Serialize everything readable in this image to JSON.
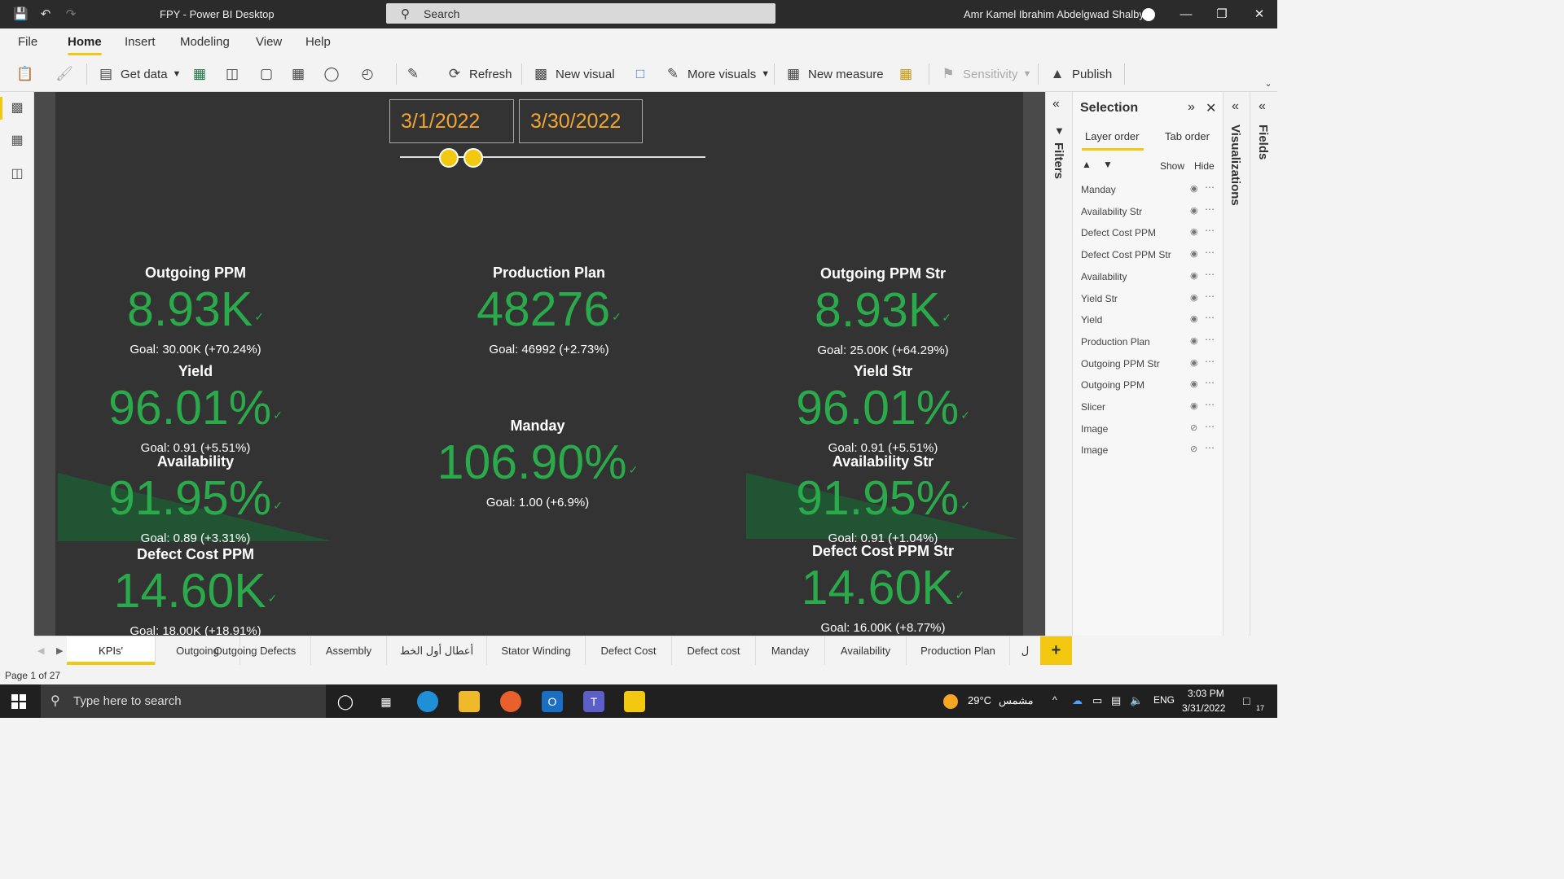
{
  "window": {
    "title": "FPY - Power BI Desktop",
    "search_placeholder": "Search",
    "user_name": "Amr Kamel Ibrahim Abdelgwad Shalby"
  },
  "menu": {
    "tabs": [
      {
        "label": "File"
      },
      {
        "label": "Home"
      },
      {
        "label": "Insert"
      },
      {
        "label": "Modeling"
      },
      {
        "label": "View"
      },
      {
        "label": "Help"
      }
    ],
    "active": "Home"
  },
  "ribbon": {
    "get_data": "Get data",
    "refresh": "Refresh",
    "new_visual": "New visual",
    "more_visuals": "More visuals",
    "new_measure": "New measure",
    "sensitivity": "Sensitivity",
    "publish": "Publish"
  },
  "report": {
    "date_start": "3/1/2022",
    "date_end": "3/30/2022",
    "slider": {
      "start_fraction": 0.16,
      "end_fraction": 0.24
    },
    "kpis": {
      "outgoing_ppm": {
        "title": "Outgoing PPM",
        "value": "8.93K",
        "goal": "Goal: 30.00K (+70.24%)"
      },
      "yield": {
        "title": "Yield",
        "value": "96.01%",
        "goal": "Goal: 0.91 (+5.51%)"
      },
      "availability": {
        "title": "Availability",
        "value": "91.95%",
        "goal": "Goal: 0.89 (+3.31%)"
      },
      "defect_cost_ppm": {
        "title": "Defect Cost PPM",
        "value": "14.60K",
        "goal": "Goal: 18.00K (+18.91%)"
      },
      "production_plan": {
        "title": "Production Plan",
        "value": "48276",
        "goal": "Goal: 46992 (+2.73%)"
      },
      "manday": {
        "title": "Manday",
        "value": "106.90%",
        "goal": "Goal: 1.00 (+6.9%)"
      },
      "outgoing_ppm_str": {
        "title": "Outgoing PPM Str",
        "value": "8.93K",
        "goal": "Goal: 25.00K (+64.29%)"
      },
      "yield_str": {
        "title": "Yield Str",
        "value": "96.01%",
        "goal": "Goal: 0.91 (+5.51%)"
      },
      "availability_str": {
        "title": "Availability Str",
        "value": "91.95%",
        "goal": "Goal: 0.91 (+1.04%)"
      },
      "defect_cost_ppm_str": {
        "title": "Defect Cost PPM Str",
        "value": "14.60K",
        "goal": "Goal: 16.00K (+8.77%)"
      }
    },
    "check_glyph": "✓"
  },
  "panes": {
    "filters": "Filters",
    "visualizations": "Visualizations",
    "fields": "Fields",
    "selection": {
      "title": "Selection",
      "tab_layer": "Layer order",
      "tab_tab": "Tab order",
      "show": "Show",
      "hide": "Hide",
      "layers": [
        {
          "name": "Manday",
          "visible": true
        },
        {
          "name": "Availability Str",
          "visible": true
        },
        {
          "name": "Defect Cost PPM",
          "visible": true
        },
        {
          "name": "Defect Cost PPM Str",
          "visible": true
        },
        {
          "name": "Availability",
          "visible": true
        },
        {
          "name": "Yield Str",
          "visible": true
        },
        {
          "name": "Yield",
          "visible": true
        },
        {
          "name": "Production Plan",
          "visible": true
        },
        {
          "name": "Outgoing PPM Str",
          "visible": true
        },
        {
          "name": "Outgoing PPM",
          "visible": true
        },
        {
          "name": "Slicer",
          "visible": true
        },
        {
          "name": "Image",
          "visible": false
        },
        {
          "name": "Image",
          "visible": false
        }
      ]
    }
  },
  "page_tabs": [
    {
      "label": "KPIs'",
      "active": true
    },
    {
      "label": "Outgoing"
    },
    {
      "label": "Outgoing Defects"
    },
    {
      "label": "Assembly"
    },
    {
      "label": "أعطال أول الخط"
    },
    {
      "label": "Stator Winding"
    },
    {
      "label": "Defect Cost"
    },
    {
      "label": "Defect cost"
    },
    {
      "label": "Manday"
    },
    {
      "label": "Availability"
    },
    {
      "label": "Production Plan"
    },
    {
      "label": "ل"
    }
  ],
  "status": {
    "page": "Page 1 of 27"
  },
  "taskbar": {
    "search_placeholder": "Type here to search",
    "weather": "29°C",
    "weather_text": "مشمس",
    "lang": "ENG",
    "time": "3:03 PM",
    "date": "3/31/2022",
    "notif_count": "17"
  },
  "colors": {
    "kpi_green": "#2aaa4a",
    "date_orange": "#f2a531",
    "accent_yellow": "#f2c811",
    "canvas": "#333333"
  }
}
